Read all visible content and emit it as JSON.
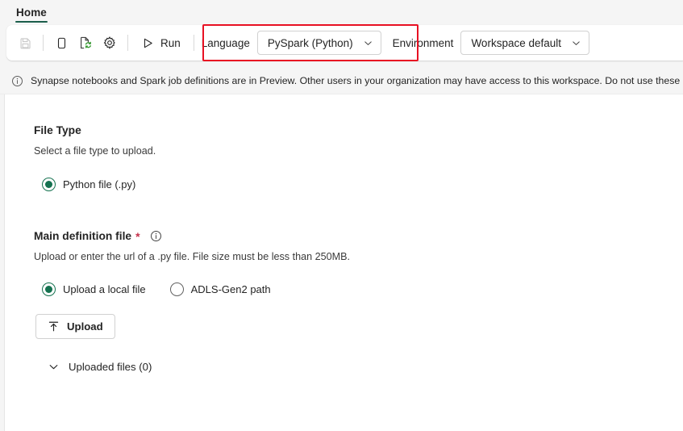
{
  "window": {
    "tab_label": "Home",
    "accent_green": "#157250",
    "highlight_color": "#e81123"
  },
  "toolbar": {
    "buttons": [
      {
        "name": "save",
        "icon": "save-icon",
        "disabled": true
      },
      {
        "name": "copy",
        "icon": "copy-icon",
        "disabled": false
      },
      {
        "name": "publish-refresh",
        "icon": "publish-refresh-icon",
        "disabled": false
      },
      {
        "name": "settings",
        "icon": "gear-icon",
        "disabled": false
      }
    ],
    "run_label": "Run",
    "language_label": "Language",
    "language_value": "PySpark (Python)",
    "environment_label": "Environment",
    "environment_value": "Workspace default"
  },
  "banner": {
    "icon": "info-circle-icon",
    "text": "Synapse notebooks and Spark job definitions are in Preview. Other users in your organization may have access to this workspace. Do not use these items"
  },
  "file_type_section": {
    "title": "File Type",
    "description": "Select a file type to upload.",
    "options": [
      {
        "label": "Python file (.py)",
        "selected": true
      }
    ]
  },
  "main_definition_section": {
    "title": "Main definition file",
    "required_marker": "*",
    "info_icon": "info-circle-icon",
    "description": "Upload or enter the url of a .py file. File size must be less than 250MB.",
    "options": [
      {
        "label": "Upload a local file",
        "selected": true
      },
      {
        "label": "ADLS-Gen2 path",
        "selected": false
      }
    ],
    "upload_button": {
      "label": "Upload",
      "icon": "upload-arrow-icon"
    },
    "uploaded_files": {
      "label": "Uploaded files (0)",
      "chevron": "chevron-down-icon",
      "expanded": false
    }
  }
}
